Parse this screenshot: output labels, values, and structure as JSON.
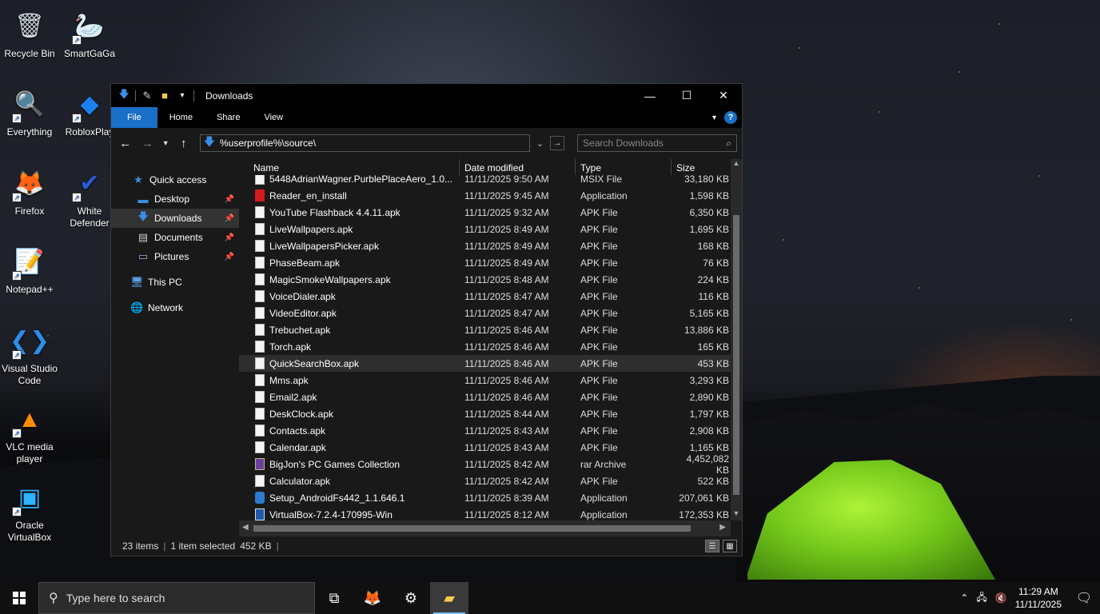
{
  "desktop": {
    "icons": [
      {
        "label": "Recycle Bin",
        "icon": "recycle-bin-icon",
        "glyph": "🗑"
      },
      {
        "label": "SmartGaGa",
        "icon": "swan-icon",
        "glyph": "🦢"
      },
      {
        "label": "Everything",
        "icon": "magnifier-icon",
        "glyph": "🔍"
      },
      {
        "label": "RobloxPlay",
        "icon": "roblox-icon",
        "glyph": "◆"
      },
      {
        "label": "Firefox",
        "icon": "firefox-icon",
        "glyph": "🦊"
      },
      {
        "label": "White Defender",
        "icon": "shield-check-icon",
        "glyph": "✔"
      },
      {
        "label": "Notepad++",
        "icon": "notepad-plus-plus-icon",
        "glyph": "📝"
      },
      {
        "label": "Visual Studio Code",
        "icon": "vscode-icon",
        "glyph": "❮❯"
      },
      {
        "label": "VLC media player",
        "icon": "vlc-cone-icon",
        "glyph": "▲"
      },
      {
        "label": "Oracle VirtualBox",
        "icon": "virtualbox-icon",
        "glyph": "▣"
      }
    ]
  },
  "explorer": {
    "title": "Downloads",
    "ribbon_tabs": [
      "File",
      "Home",
      "Share",
      "View"
    ],
    "address": "%userprofile%\\source\\",
    "search_placeholder": "Search Downloads",
    "nav": {
      "quick_access": "Quick access",
      "desktop": "Desktop",
      "downloads": "Downloads",
      "documents": "Documents",
      "pictures": "Pictures",
      "this_pc": "This PC",
      "network": "Network"
    },
    "columns": {
      "name": "Name",
      "date": "Date modified",
      "type": "Type",
      "size": "Size"
    },
    "files": [
      {
        "name": "5448AdrianWagner.PurblePlaceAero_1.0...",
        "date": "11/11/2025 9:50 AM",
        "type": "MSIX File",
        "size": "33,180 KB",
        "icon": "file"
      },
      {
        "name": "Reader_en_install",
        "date": "11/11/2025 9:45 AM",
        "type": "Application",
        "size": "1,598 KB",
        "icon": "pdf"
      },
      {
        "name": "YouTube Flashback 4.4.11.apk",
        "date": "11/11/2025 9:32 AM",
        "type": "APK File",
        "size": "6,350 KB",
        "icon": "file"
      },
      {
        "name": "LiveWallpapers.apk",
        "date": "11/11/2025 8:49 AM",
        "type": "APK File",
        "size": "1,695 KB",
        "icon": "file"
      },
      {
        "name": "LiveWallpapersPicker.apk",
        "date": "11/11/2025 8:49 AM",
        "type": "APK File",
        "size": "168 KB",
        "icon": "file"
      },
      {
        "name": "PhaseBeam.apk",
        "date": "11/11/2025 8:49 AM",
        "type": "APK File",
        "size": "76 KB",
        "icon": "file"
      },
      {
        "name": "MagicSmokeWallpapers.apk",
        "date": "11/11/2025 8:48 AM",
        "type": "APK File",
        "size": "224 KB",
        "icon": "file"
      },
      {
        "name": "VoiceDialer.apk",
        "date": "11/11/2025 8:47 AM",
        "type": "APK File",
        "size": "116 KB",
        "icon": "file"
      },
      {
        "name": "VideoEditor.apk",
        "date": "11/11/2025 8:47 AM",
        "type": "APK File",
        "size": "5,165 KB",
        "icon": "file"
      },
      {
        "name": "Trebuchet.apk",
        "date": "11/11/2025 8:46 AM",
        "type": "APK File",
        "size": "13,886 KB",
        "icon": "file"
      },
      {
        "name": "Torch.apk",
        "date": "11/11/2025 8:46 AM",
        "type": "APK File",
        "size": "165 KB",
        "icon": "file"
      },
      {
        "name": "QuickSearchBox.apk",
        "date": "11/11/2025 8:46 AM",
        "type": "APK File",
        "size": "453 KB",
        "icon": "file",
        "selected": true
      },
      {
        "name": "Mms.apk",
        "date": "11/11/2025 8:46 AM",
        "type": "APK File",
        "size": "3,293 KB",
        "icon": "file"
      },
      {
        "name": "Email2.apk",
        "date": "11/11/2025 8:46 AM",
        "type": "APK File",
        "size": "2,890 KB",
        "icon": "file"
      },
      {
        "name": "DeskClock.apk",
        "date": "11/11/2025 8:44 AM",
        "type": "APK File",
        "size": "1,797 KB",
        "icon": "file"
      },
      {
        "name": "Contacts.apk",
        "date": "11/11/2025 8:43 AM",
        "type": "APK File",
        "size": "2,908 KB",
        "icon": "file"
      },
      {
        "name": "Calendar.apk",
        "date": "11/11/2025 8:43 AM",
        "type": "APK File",
        "size": "1,165 KB",
        "icon": "file"
      },
      {
        "name": "BigJon's PC Games Collection",
        "date": "11/11/2025 8:42 AM",
        "type": "rar Archive",
        "size": "4,452,082 KB",
        "icon": "rar"
      },
      {
        "name": "Calculator.apk",
        "date": "11/11/2025 8:42 AM",
        "type": "APK File",
        "size": "522 KB",
        "icon": "file"
      },
      {
        "name": "Setup_AndroidFs442_1.1.646.1",
        "date": "11/11/2025 8:39 AM",
        "type": "Application",
        "size": "207,061 KB",
        "icon": "setup"
      },
      {
        "name": "VirtualBox-7.2.4-170995-Win",
        "date": "11/11/2025 8:12 AM",
        "type": "Application",
        "size": "172,353 KB",
        "icon": "vbox"
      }
    ],
    "status": {
      "items": "23 items",
      "selected": "1 item selected",
      "size": "452 KB"
    }
  },
  "taskbar": {
    "search_placeholder": "Type here to search",
    "time": "11:29 AM",
    "date": "11/11/2025"
  },
  "colors": {
    "accent": "#1a6fc6",
    "selection": "#2e2e2e",
    "tent": "#8fe12a"
  }
}
